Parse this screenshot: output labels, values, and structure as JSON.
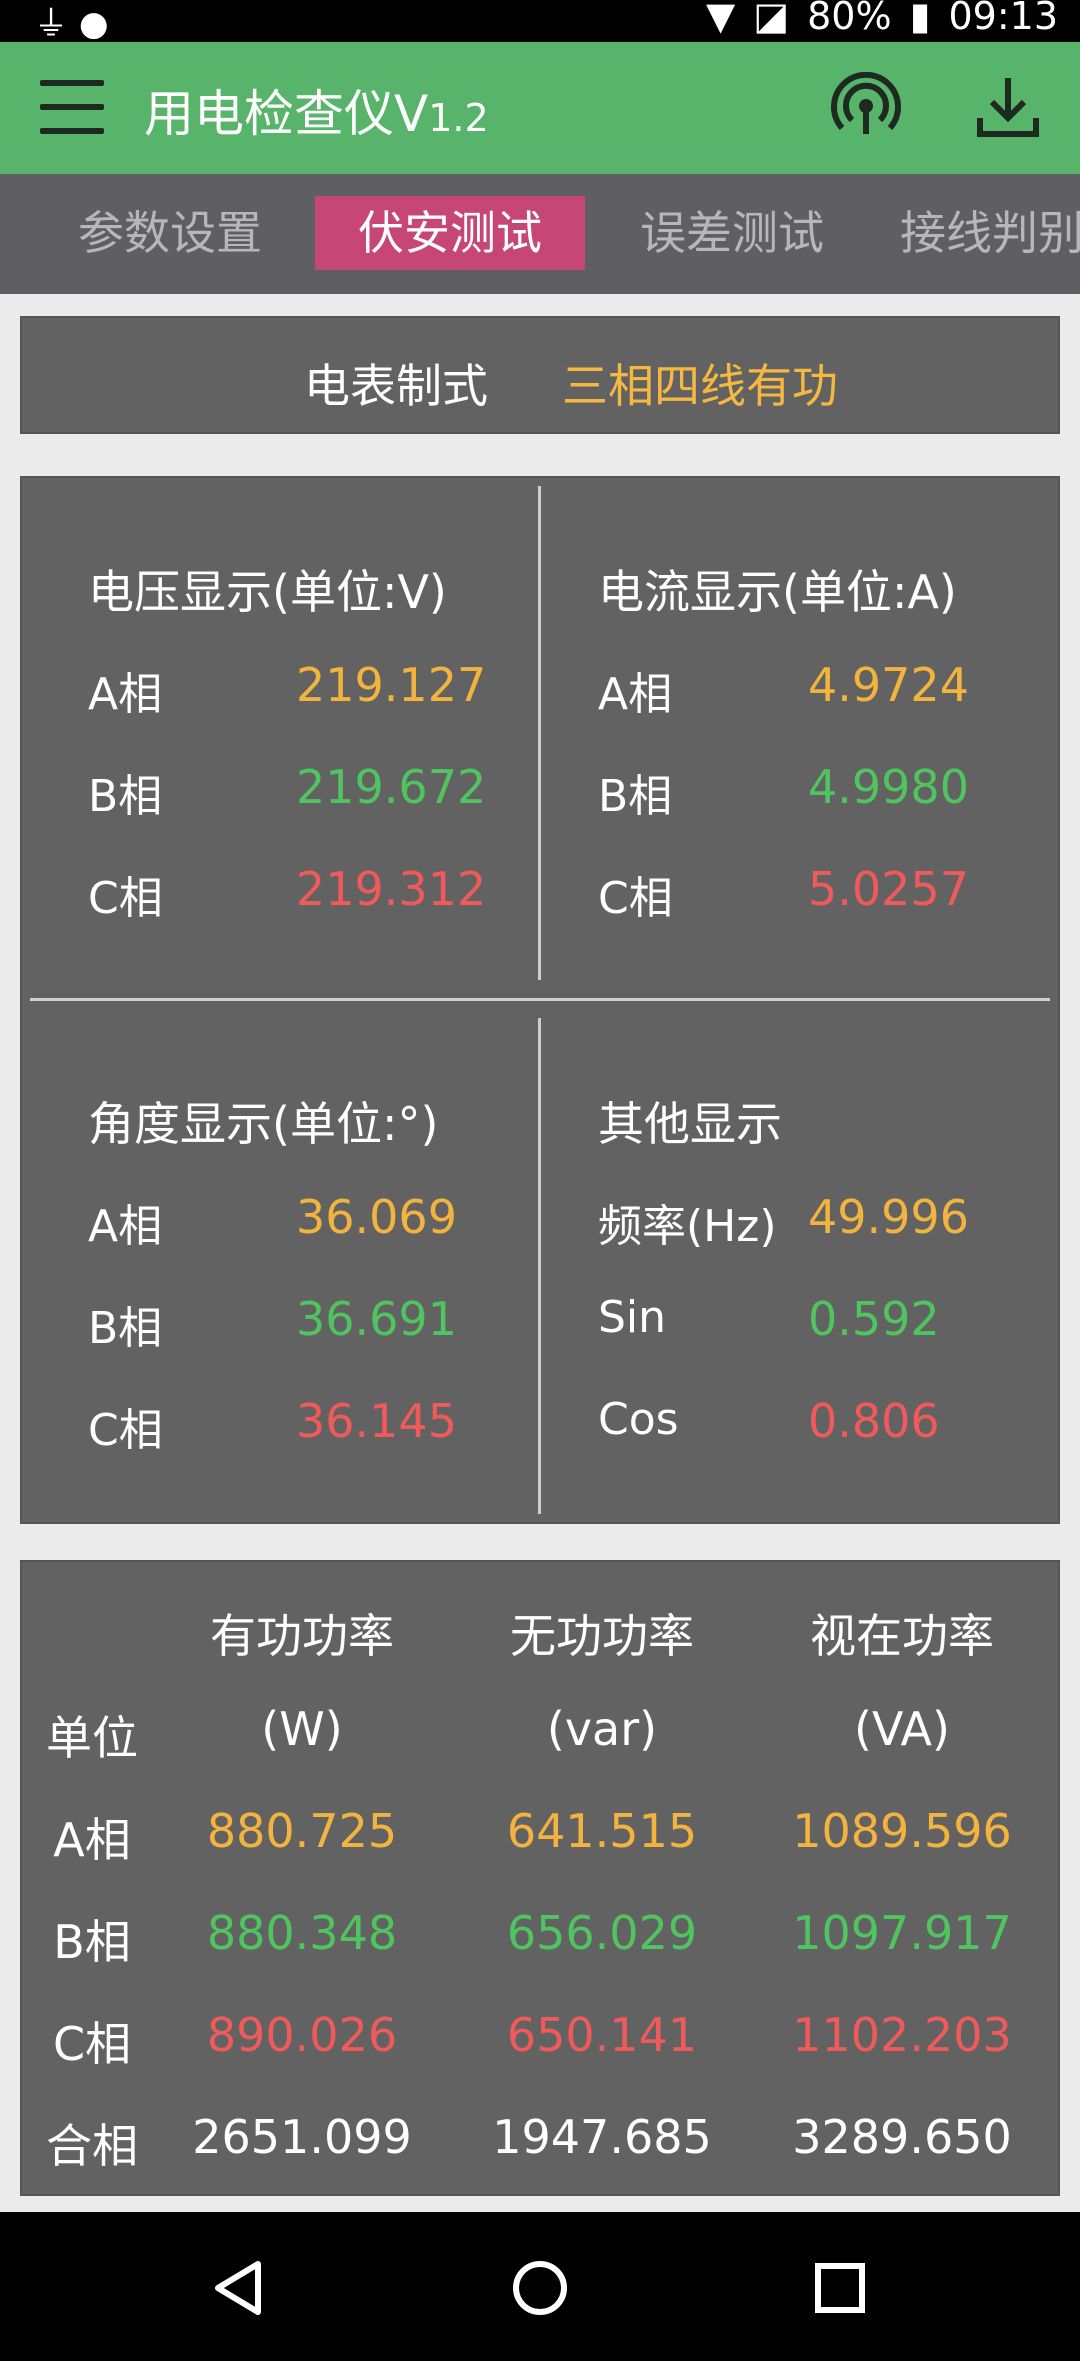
{
  "status": {
    "battery": "80%",
    "time": "09:13"
  },
  "app": {
    "title": "用电检查仪V",
    "version": "1.2"
  },
  "tabs": [
    {
      "label": "参数设置"
    },
    {
      "label": "伏安测试"
    },
    {
      "label": "误差测试"
    },
    {
      "label": "接线判别"
    }
  ],
  "meter": {
    "label": "电表制式",
    "value": "三相四线有功"
  },
  "voltage": {
    "title": "电压显示(单位:V)",
    "rows": [
      {
        "label": "A相",
        "value": "219.127"
      },
      {
        "label": "B相",
        "value": "219.672"
      },
      {
        "label": "C相",
        "value": "219.312"
      }
    ]
  },
  "current": {
    "title": "电流显示(单位:A)",
    "rows": [
      {
        "label": "A相",
        "value": "4.9724"
      },
      {
        "label": "B相",
        "value": "4.9980"
      },
      {
        "label": "C相",
        "value": "5.0257"
      }
    ]
  },
  "angle": {
    "title": "角度显示(单位:°)",
    "rows": [
      {
        "label": "A相",
        "value": "36.069"
      },
      {
        "label": "B相",
        "value": "36.691"
      },
      {
        "label": "C相",
        "value": "36.145"
      }
    ]
  },
  "other": {
    "title": "其他显示",
    "rows": [
      {
        "label": "频率(Hz)",
        "value": "49.996"
      },
      {
        "label": "Sin",
        "value": "0.592"
      },
      {
        "label": "Cos",
        "value": "0.806"
      }
    ]
  },
  "power": {
    "headers": [
      "有功功率",
      "无功功率",
      "视在功率"
    ],
    "unit_label": "单位",
    "units": [
      "(W)",
      "(var)",
      "(VA)"
    ],
    "rows": [
      {
        "label": "A相",
        "values": [
          "880.725",
          "641.515",
          "1089.596"
        ]
      },
      {
        "label": "B相",
        "values": [
          "880.348",
          "656.029",
          "1097.917"
        ]
      },
      {
        "label": "C相",
        "values": [
          "890.026",
          "650.141",
          "1102.203"
        ]
      },
      {
        "label": "合相",
        "values": [
          "2651.099",
          "1947.685",
          "3289.650"
        ]
      }
    ]
  },
  "colors": {
    "appbar": "#58b46a",
    "active_tab": "#c64775",
    "phase_a": "#f2b43e",
    "phase_b": "#4fc45f",
    "phase_c": "#f05a5a"
  }
}
